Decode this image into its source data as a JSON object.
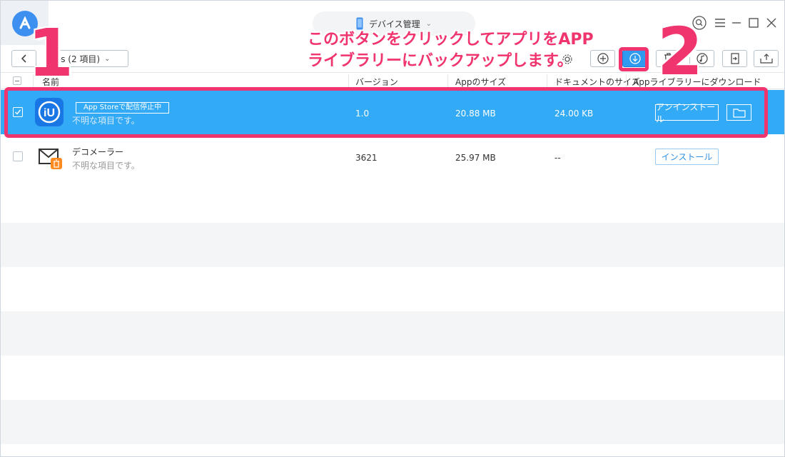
{
  "titlebar": {
    "device_label": "デバイス管理"
  },
  "toolbar": {
    "apps_dropdown_label": "pps (2 項目)"
  },
  "table": {
    "headers": {
      "name": "名前",
      "version": "バージョン",
      "app_size": "Appのサイズ",
      "doc_size": "ドキュメントのサイズ",
      "library": "Appライブラリーにダウンロード"
    },
    "rows": [
      {
        "name": "",
        "badge": "App Storeで配信停止中",
        "subtitle": "不明な項目です。",
        "version": "1.0",
        "app_size": "20.88 MB",
        "doc_size": "24.00 KB",
        "action": "アンインストール",
        "selected": true
      },
      {
        "name": "デコメーラー",
        "subtitle": "不明な項目です。",
        "version": "3621",
        "app_size": "25.97 MB",
        "doc_size": "--",
        "action": "インストール",
        "selected": false
      }
    ]
  },
  "annotations": {
    "step1": "1",
    "step2": "2",
    "callout_line1": "このボタンをクリックしてアプリをAPP",
    "callout_line2": "ライブラリーにバックアップします。"
  },
  "colors": {
    "selected_row": "#33aaf5",
    "annotation": "#f0346e",
    "accent": "#2f9af0"
  }
}
